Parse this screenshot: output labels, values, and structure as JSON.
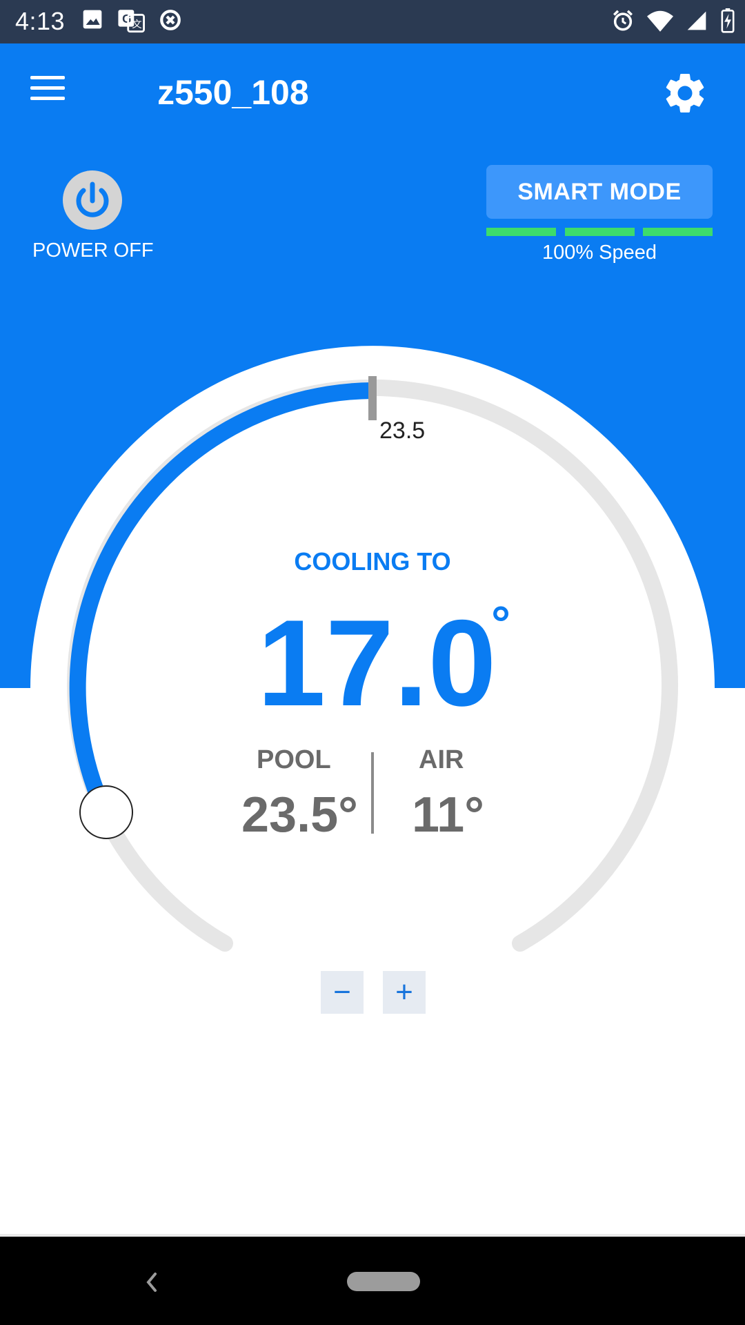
{
  "status_bar": {
    "time": "4:13",
    "left_icons": [
      "image-icon",
      "translate-icon",
      "data-saver-icon"
    ],
    "right_icons": [
      "alarm-icon",
      "wifi-icon",
      "signal-icon",
      "battery-charging-icon"
    ]
  },
  "app_bar": {
    "title": "z550_108",
    "menu_icon": "menu-icon",
    "settings_icon": "gear-icon"
  },
  "controls": {
    "power_label": "POWER OFF",
    "smart_mode_label": "SMART MODE",
    "speed_label": "100% Speed",
    "speed_level": 1.0
  },
  "dial": {
    "marker_value": "23.5",
    "mode_label": "COOLING TO",
    "target_temp": "17.0",
    "degree_symbol": "°",
    "pool_label": "POOL",
    "pool_value": "23.5°",
    "air_label": "AIR",
    "air_value": "11°"
  },
  "steppers": {
    "minus_label": "−",
    "plus_label": "+"
  },
  "colors": {
    "primary_blue": "#0a7cf2",
    "speed_green": "#3ddc6c",
    "track_gray": "#e6e6e6",
    "text_gray": "#6a6a6a",
    "status_bar": "#2b3a52"
  }
}
